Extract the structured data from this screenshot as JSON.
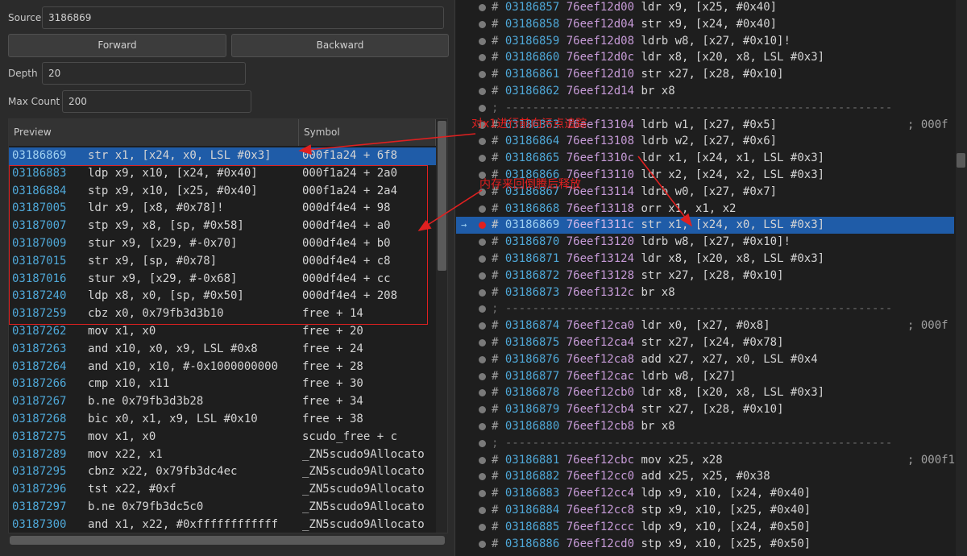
{
  "form": {
    "source_label": "Source",
    "source_value": "3186869",
    "forward_label": "Forward",
    "backward_label": "Backward",
    "depth_label": "Depth",
    "depth_value": "20",
    "maxcount_label": "Max Count",
    "maxcount_value": "200"
  },
  "table": {
    "columns": [
      "Preview",
      "Symbol"
    ],
    "rows": [
      {
        "id": "03186869",
        "ins": "str x1, [x24, x0, LSL #0x3]",
        "sym": "000f1a24 + 6f8"
      },
      {
        "id": "03186883",
        "ins": "ldp x9, x10, [x24, #0x40]",
        "sym": "000f1a24 + 2a0"
      },
      {
        "id": "03186884",
        "ins": "stp x9, x10, [x25, #0x40]",
        "sym": "000f1a24 + 2a4"
      },
      {
        "id": "03187005",
        "ins": "ldr x9, [x8, #0x78]!",
        "sym": "000df4e4 + 98"
      },
      {
        "id": "03187007",
        "ins": "stp x9, x8, [sp, #0x58]",
        "sym": "000df4e4 + a0"
      },
      {
        "id": "03187009",
        "ins": "stur x9, [x29, #-0x70]",
        "sym": "000df4e4 + b0"
      },
      {
        "id": "03187015",
        "ins": "str x9, [sp, #0x78]",
        "sym": "000df4e4 + c8"
      },
      {
        "id": "03187016",
        "ins": "stur x9, [x29, #-0x68]",
        "sym": "000df4e4 + cc"
      },
      {
        "id": "03187240",
        "ins": "ldp x8, x0, [sp, #0x50]",
        "sym": "000df4e4 + 208"
      },
      {
        "id": "03187259",
        "ins": "cbz x0, 0x79fb3d3b10",
        "sym": "free + 14"
      },
      {
        "id": "03187262",
        "ins": "mov x1, x0",
        "sym": "free + 20"
      },
      {
        "id": "03187263",
        "ins": "and x10, x0, x9, LSL #0x8",
        "sym": "free + 24"
      },
      {
        "id": "03187264",
        "ins": "and x10, x10, #-0x1000000000",
        "sym": "free + 28"
      },
      {
        "id": "03187266",
        "ins": "cmp x10, x11",
        "sym": "free + 30"
      },
      {
        "id": "03187267",
        "ins": "b.ne 0x79fb3d3b28",
        "sym": "free + 34"
      },
      {
        "id": "03187268",
        "ins": "bic x0, x1, x9, LSL #0x10",
        "sym": "free + 38"
      },
      {
        "id": "03187275",
        "ins": "mov x1, x0",
        "sym": "scudo_free + c"
      },
      {
        "id": "03187289",
        "ins": "mov x22, x1",
        "sym": "_ZN5scudo9Allocato"
      },
      {
        "id": "03187295",
        "ins": "cbnz x22, 0x79fb3dc4ec",
        "sym": "_ZN5scudo9Allocato"
      },
      {
        "id": "03187296",
        "ins": "tst x22, #0xf",
        "sym": "_ZN5scudo9Allocato"
      },
      {
        "id": "03187297",
        "ins": "b.ne 0x79fb3dc5c0",
        "sym": "_ZN5scudo9Allocato"
      },
      {
        "id": "03187300",
        "ins": "and x1, x22, #0xffffffffffff",
        "sym": "_ZN5scudo9Allocato"
      }
    ]
  },
  "trace": {
    "rows": [
      {
        "type": "ins",
        "num": "03186857",
        "addr": "76eef12d00",
        "mn": "ldr",
        "ops": "x9, [x25, #0x40]"
      },
      {
        "type": "ins",
        "num": "03186858",
        "addr": "76eef12d04",
        "mn": "str",
        "ops": "x9, [x24, #0x40]"
      },
      {
        "type": "ins",
        "num": "03186859",
        "addr": "76eef12d08",
        "mn": "ldrb",
        "ops": "w8, [x27, #0x10]!"
      },
      {
        "type": "ins",
        "num": "03186860",
        "addr": "76eef12d0c",
        "mn": "ldr",
        "ops": "x8, [x20, x8, LSL #0x3]"
      },
      {
        "type": "ins",
        "num": "03186861",
        "addr": "76eef12d10",
        "mn": "str",
        "ops": "x27, [x28, #0x10]"
      },
      {
        "type": "ins",
        "num": "03186862",
        "addr": "76eef12d14",
        "mn": "br",
        "ops": "x8"
      },
      {
        "type": "sep",
        "text": "; ---------------------------------------------------------"
      },
      {
        "type": "ins",
        "num": "03186863",
        "addr": "76eef13104",
        "mn": "ldrb",
        "ops": "w1, [x27, #0x5]",
        "cmt": "; 000f"
      },
      {
        "type": "ins",
        "num": "03186864",
        "addr": "76eef13108",
        "mn": "ldrb",
        "ops": "w2, [x27, #0x6]"
      },
      {
        "type": "ins",
        "num": "03186865",
        "addr": "76eef1310c",
        "mn": "ldr",
        "ops": "x1, [x24, x1, LSL #0x3]"
      },
      {
        "type": "ins",
        "num": "03186866",
        "addr": "76eef13110",
        "mn": "ldr",
        "ops": "x2, [x24, x2, LSL #0x3]"
      },
      {
        "type": "ins",
        "num": "03186867",
        "addr": "76eef13114",
        "mn": "ldrb",
        "ops": "w0, [x27, #0x7]"
      },
      {
        "type": "ins",
        "num": "03186868",
        "addr": "76eef13118",
        "mn": "orr",
        "ops": "x1, x1, x2"
      },
      {
        "type": "ins",
        "num": "03186869",
        "addr": "76eef1311c",
        "mn": "str",
        "ops": "x1, [x24, x0, LSL #0x3]",
        "sel": true
      },
      {
        "type": "ins",
        "num": "03186870",
        "addr": "76eef13120",
        "mn": "ldrb",
        "ops": "w8, [x27, #0x10]!"
      },
      {
        "type": "ins",
        "num": "03186871",
        "addr": "76eef13124",
        "mn": "ldr",
        "ops": "x8, [x20, x8, LSL #0x3]"
      },
      {
        "type": "ins",
        "num": "03186872",
        "addr": "76eef13128",
        "mn": "str",
        "ops": "x27, [x28, #0x10]"
      },
      {
        "type": "ins",
        "num": "03186873",
        "addr": "76eef1312c",
        "mn": "br",
        "ops": "x8"
      },
      {
        "type": "sep",
        "text": "; ---------------------------------------------------------"
      },
      {
        "type": "ins",
        "num": "03186874",
        "addr": "76eef12ca0",
        "mn": "ldr",
        "ops": "x0, [x27, #0x8]",
        "cmt": "; 000f"
      },
      {
        "type": "ins",
        "num": "03186875",
        "addr": "76eef12ca4",
        "mn": "str",
        "ops": "x27, [x24, #0x78]"
      },
      {
        "type": "ins",
        "num": "03186876",
        "addr": "76eef12ca8",
        "mn": "add",
        "ops": "x27, x27, x0, LSL #0x4"
      },
      {
        "type": "ins",
        "num": "03186877",
        "addr": "76eef12cac",
        "mn": "ldrb",
        "ops": "w8, [x27]"
      },
      {
        "type": "ins",
        "num": "03186878",
        "addr": "76eef12cb0",
        "mn": "ldr",
        "ops": "x8, [x20, x8, LSL #0x3]"
      },
      {
        "type": "ins",
        "num": "03186879",
        "addr": "76eef12cb4",
        "mn": "str",
        "ops": "x27, [x28, #0x10]"
      },
      {
        "type": "ins",
        "num": "03186880",
        "addr": "76eef12cb8",
        "mn": "br",
        "ops": "x8"
      },
      {
        "type": "sep",
        "text": "; ---------------------------------------------------------"
      },
      {
        "type": "ins",
        "num": "03186881",
        "addr": "76eef12cbc",
        "mn": "mov",
        "ops": "x25, x28",
        "cmt": "; 000f1"
      },
      {
        "type": "ins",
        "num": "03186882",
        "addr": "76eef12cc0",
        "mn": "add",
        "ops": "x25, x25, #0x38"
      },
      {
        "type": "ins",
        "num": "03186883",
        "addr": "76eef12cc4",
        "mn": "ldp",
        "ops": "x9, x10, [x24, #0x40]"
      },
      {
        "type": "ins",
        "num": "03186884",
        "addr": "76eef12cc8",
        "mn": "stp",
        "ops": "x9, x10, [x25, #0x40]"
      },
      {
        "type": "ins",
        "num": "03186885",
        "addr": "76eef12ccc",
        "mn": "ldp",
        "ops": "x9, x10, [x24, #0x50]"
      },
      {
        "type": "ins",
        "num": "03186886",
        "addr": "76eef12cd0",
        "mn": "stp",
        "ops": "x9, x10, [x25, #0x50]"
      }
    ]
  },
  "annotations": {
    "note1": "对x1进行前向污点追踪",
    "note2": "内存来回倒腾后释放"
  },
  "colors": {
    "accent": "#1f5ca8",
    "annotation": "#e02020"
  }
}
